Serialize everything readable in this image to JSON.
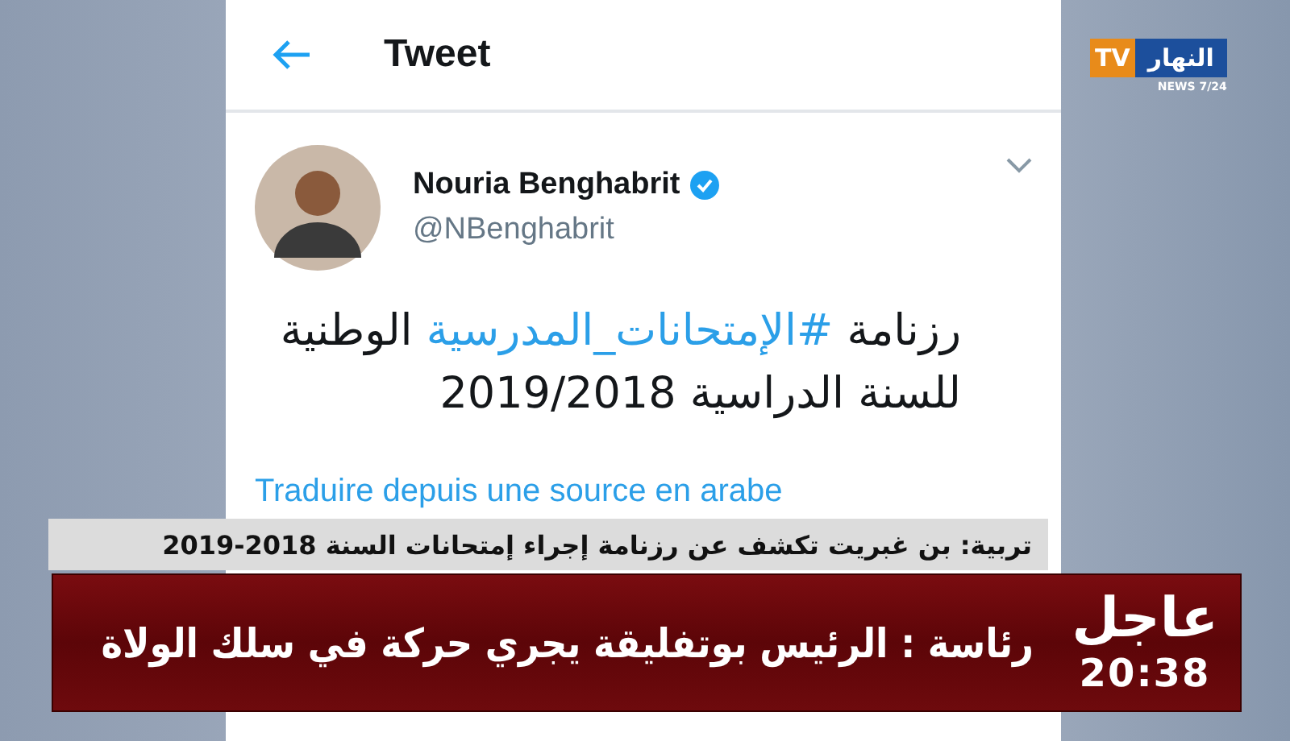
{
  "logo": {
    "badge": "TV",
    "name": "النهار",
    "tagline": "NEWS 7/24"
  },
  "tweet_screen": {
    "title": "Tweet",
    "author": {
      "name": "Nouria Benghabrit",
      "handle": "@NBenghabrit",
      "verified": true
    },
    "text_before": "رزنامة",
    "hashtag": "#الإمتحانات_المدرسية",
    "text_after": "الوطنية للسنة الدراسية 2019/2018",
    "translate_link": "Traduire depuis une source en arabe"
  },
  "subtitle_strip": "تربية: بن غبريت تكشف عن رزنامة إجراء إمتحانات السنة 2018-2019",
  "breaking_banner": {
    "label": "عاجل",
    "time": "20:38",
    "headline": "رئاسة : الرئيس  بوتفليقة يجري حركة  في سلك الولاة"
  }
}
